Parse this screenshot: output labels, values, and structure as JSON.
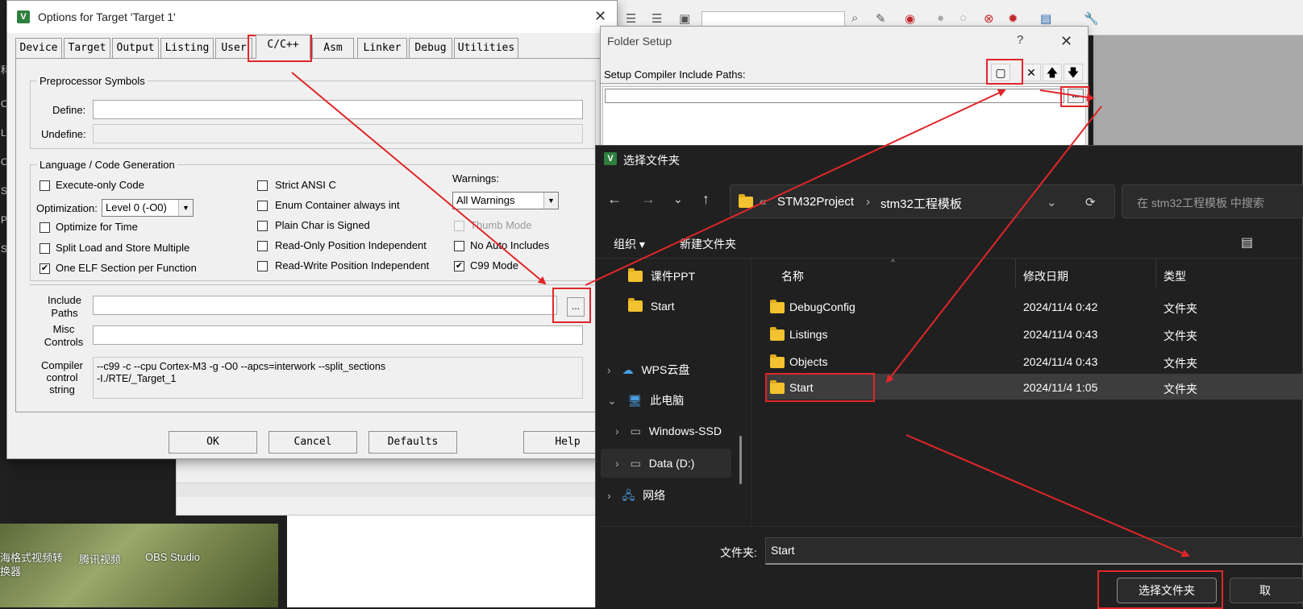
{
  "background": {
    "taskbar_items": [
      "海格式视频转换器",
      "腾讯视频",
      "OBS Studio"
    ],
    "left_strip_chars": [
      "Li",
      "O",
      "S",
      "P",
      "S",
      "科",
      "O"
    ]
  },
  "options_dialog": {
    "logo": "V",
    "title": "Options for Target 'Target 1'",
    "tabs": [
      "Device",
      "Target",
      "Output",
      "Listing",
      "User",
      "C/C++",
      "Asm",
      "Linker",
      "Debug",
      "Utilities"
    ],
    "active_tab": "C/C++",
    "preprocessor": {
      "legend": "Preprocessor Symbols",
      "define_label": "Define:",
      "define_value": "",
      "undefine_label": "Undefine:",
      "undefine_value": ""
    },
    "codegen": {
      "legend": "Language / Code Generation",
      "execute_only": {
        "label": "Execute-only Code",
        "checked": false
      },
      "optimization_label": "Optimization:",
      "optimization_value": "Level 0 (-O0)",
      "optimize_time": {
        "label": "Optimize for Time",
        "checked": false
      },
      "split_load": {
        "label": "Split Load and Store Multiple",
        "checked": false
      },
      "one_elf": {
        "label": "One ELF Section per Function",
        "checked": true
      },
      "strict_ansi": {
        "label": "Strict ANSI C",
        "checked": false
      },
      "enum_container": {
        "label": "Enum Container always int",
        "checked": false
      },
      "plain_char": {
        "label": "Plain Char is Signed",
        "checked": false
      },
      "ro_position": {
        "label": "Read-Only Position Independent",
        "checked": false
      },
      "rw_position": {
        "label": "Read-Write Position Independent",
        "checked": false
      },
      "warnings_label": "Warnings:",
      "warnings_value": "All Warnings",
      "thumb_mode": {
        "label": "Thumb Mode",
        "checked": false,
        "disabled": true
      },
      "no_auto_includes": {
        "label": "No Auto Includes",
        "checked": false
      },
      "c99_mode": {
        "label": "C99 Mode",
        "checked": true
      }
    },
    "include_paths_label_1": "Include",
    "include_paths_label_2": "Paths",
    "include_paths_value": "",
    "browse_label": "...",
    "misc_label_1": "Misc",
    "misc_label_2": "Controls",
    "misc_value": "",
    "compiler_label_1": "Compiler",
    "compiler_label_2": "control",
    "compiler_label_3": "string",
    "compiler_line_1": "--c99 -c --cpu Cortex-M3 -g -O0 --apcs=interwork --split_sections",
    "compiler_line_2": "-I./RTE/_Target_1",
    "buttons": {
      "ok": "OK",
      "cancel": "Cancel",
      "defaults": "Defaults",
      "help": "Help"
    }
  },
  "folder_setup": {
    "title": "Folder Setup",
    "help": "?",
    "heading": "Setup Compiler Include Paths:",
    "browse_label": "...",
    "entry_value": ""
  },
  "picker": {
    "logo": "V",
    "title": "选择文件夹",
    "breadcrumb": [
      "STM32Project",
      "stm32工程模板"
    ],
    "breadcrumb_prefix": "«",
    "search_placeholder": "在 stm32工程模板 中搜索",
    "organize": "组织 ▾",
    "new_folder": "新建文件夹",
    "sidebar": [
      {
        "label": "课件PPT",
        "type": "folder"
      },
      {
        "label": "Start",
        "type": "folder"
      },
      {
        "label": "WPS云盘",
        "type": "cloud"
      },
      {
        "label": "此电脑",
        "type": "pc"
      },
      {
        "label": "Windows-SSD",
        "type": "drive"
      },
      {
        "label": "Data (D:)",
        "type": "drive"
      },
      {
        "label": "网络",
        "type": "network"
      }
    ],
    "columns": {
      "name": "名称",
      "date": "修改日期",
      "type": "类型"
    },
    "rows": [
      {
        "name": "DebugConfig",
        "date": "2024/11/4 0:42",
        "type": "文件夹"
      },
      {
        "name": "Listings",
        "date": "2024/11/4 0:43",
        "type": "文件夹"
      },
      {
        "name": "Objects",
        "date": "2024/11/4 0:43",
        "type": "文件夹"
      },
      {
        "name": "Start",
        "date": "2024/11/4 1:05",
        "type": "文件夹"
      }
    ],
    "folder_label": "文件夹:",
    "folder_value": "Start",
    "select_button": "选择文件夹",
    "cancel_button": "取"
  },
  "colors": {
    "highlight": "#e0262a",
    "dark_bg": "#202020",
    "dialog_bg": "#f0f0f0",
    "folder_yellow": "#f2c230"
  }
}
